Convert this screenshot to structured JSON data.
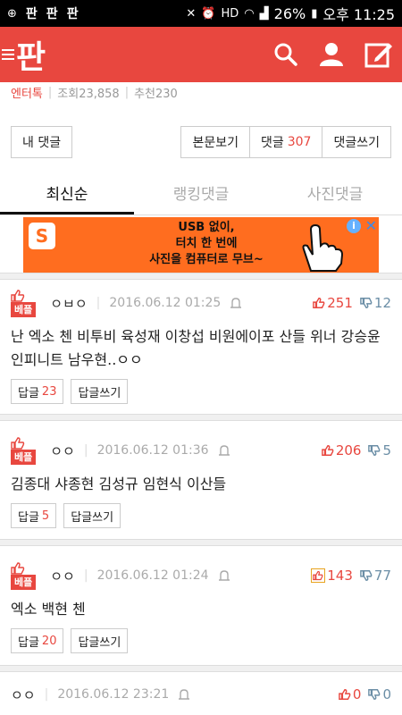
{
  "status_bar": {
    "app_icons": [
      "판",
      "판",
      "판"
    ],
    "battery": "26%",
    "time": "오후 11:25"
  },
  "header": {
    "logo": "판"
  },
  "post_info": {
    "category": "엔터톡",
    "views": "조회23,858",
    "recommend": "추천230"
  },
  "buttons": {
    "my_comments": "내 댓글",
    "view_post": "본문보기",
    "comments_label": "댓글",
    "comments_count": "307",
    "write_comment": "댓글쓰기"
  },
  "tabs": [
    {
      "label": "최신순",
      "active": true
    },
    {
      "label": "랭킹댓글",
      "active": false
    },
    {
      "label": "사진댓글",
      "active": false
    }
  ],
  "ad": {
    "logo": "S",
    "line1": "USB 없이,",
    "line2": "터치 한 번에",
    "line3": "사진을 컴퓨터로     무브~"
  },
  "comments": [
    {
      "badge": "베플",
      "author": "ㅇㅂㅇ",
      "date": "2016.06.12 01:25",
      "up": "251",
      "down": "12",
      "text": "난 엑소 첸 비투비 육성재 이창섭 비원에이포 산들 위너 강승윤 인피니트 남우현..ㅇㅇ",
      "reply_label": "답글",
      "reply_count": "23",
      "write_reply": "답글쓰기"
    },
    {
      "badge": "베플",
      "author": "ㅇㅇ",
      "date": "2016.06.12 01:36",
      "up": "206",
      "down": "5",
      "text": "김종대 샤종현 김성규 임현식 이산들",
      "reply_label": "답글",
      "reply_count": "5",
      "write_reply": "답글쓰기"
    },
    {
      "badge": "베플",
      "author": "ㅇㅇ",
      "date": "2016.06.12 01:24",
      "up": "143",
      "down": "77",
      "text": "엑소 백현 첸",
      "reply_label": "답글",
      "reply_count": "20",
      "write_reply": "답글쓰기"
    },
    {
      "author": "ㅇㅇ",
      "date": "2016.06.12 23:21",
      "up": "0",
      "down": "0"
    }
  ],
  "colors": {
    "brand": "#e8473f",
    "ad_bg": "#ff6d1f"
  }
}
